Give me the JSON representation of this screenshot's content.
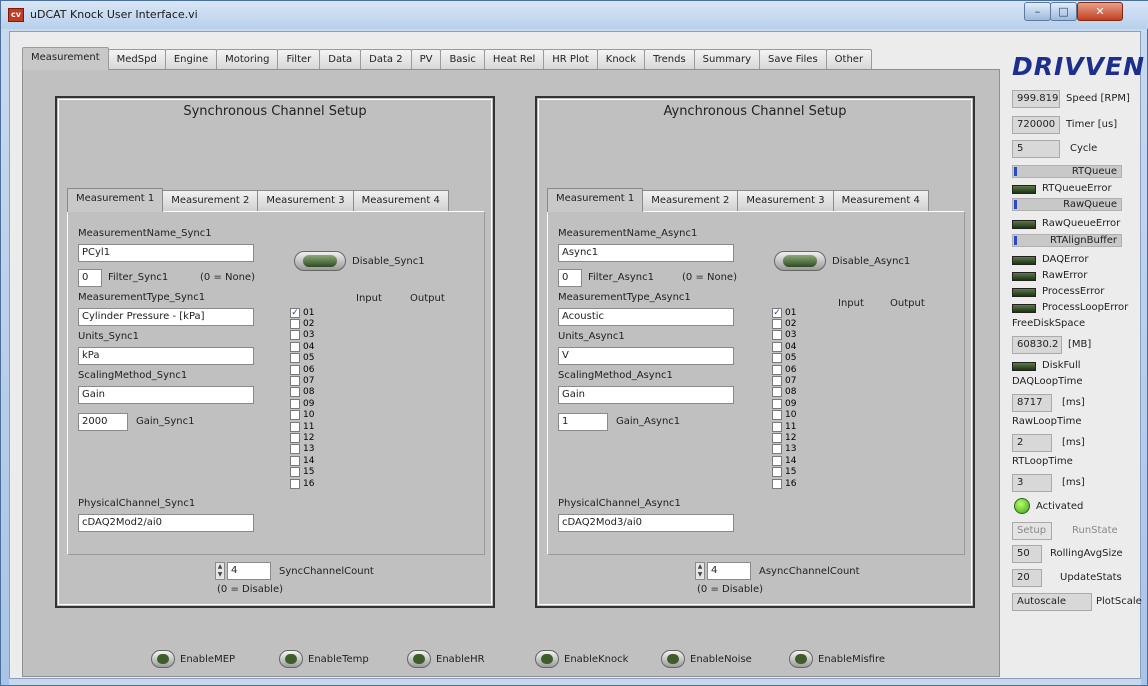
{
  "window": {
    "title": "uDCAT Knock User Interface.vi",
    "icon_text": "cv"
  },
  "tabs": [
    "Measurement",
    "MedSpd",
    "Engine",
    "Motoring",
    "Filter",
    "Data",
    "Data 2",
    "PV",
    "Basic",
    "Heat Rel",
    "HR Plot",
    "Knock",
    "Trends",
    "Summary",
    "Save Files",
    "Other"
  ],
  "sync": {
    "title": "Synchronous Channel Setup",
    "subtabs": [
      "Measurement 1",
      "Measurement 2",
      "Measurement 3",
      "Measurement 4"
    ],
    "name_label": "MeasurementName_Sync1",
    "name_value": "PCyl1",
    "filter_value": "0",
    "filter_label": "Filter_Sync1",
    "filter_note": "(0 = None)",
    "disable_label": "Disable_Sync1",
    "type_label": "MeasurementType_Sync1",
    "type_value": "Cylinder Pressure - [kPa]",
    "units_label": "Units_Sync1",
    "units_value": "kPa",
    "scaling_label": "ScalingMethod_Sync1",
    "scaling_value": "Gain",
    "gain_value": "2000",
    "gain_label": "Gain_Sync1",
    "phys_label": "PhysicalChannel_Sync1",
    "phys_value": "cDAQ2Mod2/ai0",
    "input_label": "Input",
    "output_label": "Output",
    "count_value": "4",
    "count_label": "SyncChannelCount",
    "count_note": "(0 = Disable)"
  },
  "async": {
    "title": "Aynchronous Channel Setup",
    "subtabs": [
      "Measurement 1",
      "Measurement 2",
      "Measurement 3",
      "Measurement 4"
    ],
    "name_label": "MeasurementName_Async1",
    "name_value": "Async1",
    "filter_value": "0",
    "filter_label": "Filter_Async1",
    "filter_note": "(0 = None)",
    "disable_label": "Disable_Async1",
    "type_label": "MeasurementType_Async1",
    "type_value": "Acoustic",
    "units_label": "Units_Async1",
    "units_value": "V",
    "scaling_label": "ScalingMethod_Async1",
    "scaling_value": "Gain",
    "gain_value": "1",
    "gain_label": "Gain_Async1",
    "phys_label": "PhysicalChannel_Async1",
    "phys_value": "cDAQ2Mod3/ai0",
    "input_label": "Input",
    "output_label": "Output",
    "count_value": "4",
    "count_label": "AsyncChannelCount",
    "count_note": "(0 = Disable)"
  },
  "channels": [
    "01",
    "02",
    "03",
    "04",
    "05",
    "06",
    "07",
    "08",
    "09",
    "10",
    "11",
    "12",
    "13",
    "14",
    "15",
    "16"
  ],
  "checked_channel": "01",
  "enable_buttons": [
    "EnableMEP",
    "EnableTemp",
    "EnableHR",
    "EnableKnock",
    "EnableNoise",
    "EnableMisfire"
  ],
  "sidebar": {
    "logo": "DRIVVEN",
    "speed_value": "999.819",
    "speed_label": "Speed [RPM]",
    "timer_value": "720000",
    "timer_label": "Timer [us]",
    "cycle_value": "5",
    "cycle_label": "Cycle",
    "rtqueue_label": "RTQueue",
    "rtqueue_error_label": "RTQueueError",
    "rawqueue_label": "RawQueue",
    "rawqueue_error_label": "RawQueueError",
    "rtalign_label": "RTAlignBuffer",
    "daq_error_label": "DAQError",
    "raw_error_label": "RawError",
    "process_error_label": "ProcessError",
    "process_loop_error_label": "ProcessLoopError",
    "freedisk_label": "FreeDiskSpace",
    "freedisk_value": "60830.2",
    "freedisk_unit": "[MB]",
    "diskfull_label": "DiskFull",
    "daqloop_label": "DAQLoopTime",
    "daqloop_value": "8717",
    "daqloop_unit": "[ms]",
    "rawloop_label": "RawLoopTime",
    "rawloop_value": "2",
    "rawloop_unit": "[ms]",
    "rtloop_label": "RTLoopTime",
    "rtloop_value": "3",
    "rtloop_unit": "[ms]",
    "activated_label": "Activated",
    "runstate_value": "Setup",
    "runstate_label": "RunState",
    "rollingavg_value": "50",
    "rollingavg_label": "RollingAvgSize",
    "updatestats_value": "20",
    "updatestats_label": "UpdateStats",
    "plotscale_value": "Autoscale",
    "plotscale_label": "PlotScale"
  }
}
